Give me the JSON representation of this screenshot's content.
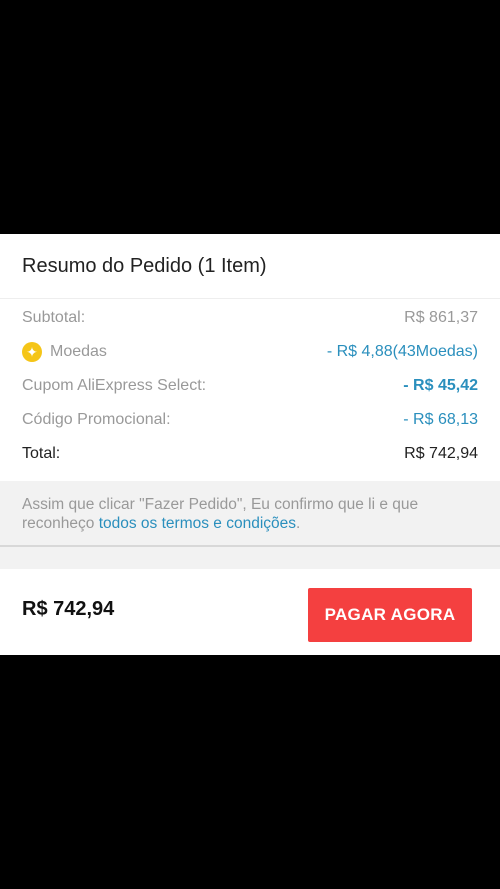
{
  "summary": {
    "title": "Resumo do Pedido (1 Item)",
    "rows": [
      {
        "label": "Subtotal:",
        "value": "R$ 861,37"
      },
      {
        "label": "Moedas",
        "value": "- R$ 4,88(43Moedas)",
        "icon": "coin-icon"
      },
      {
        "label": "Cupom AliExpress Select:",
        "value": "- R$ 45,42"
      },
      {
        "label": "Código Promocional:",
        "value": "- R$ 68,13"
      },
      {
        "label": "Total:",
        "value": "R$ 742,94"
      }
    ]
  },
  "terms": {
    "text": "Assim que clicar \"Fazer Pedido\", Eu confirmo que li e que reconheço ",
    "link": "todos os termos e condições",
    "suffix": "."
  },
  "footer": {
    "total": "R$ 742,94",
    "pay_label": "PAGAR AGORA"
  },
  "colors": {
    "accent_red": "#f44040",
    "link_blue": "#2a8fbd",
    "coin_yellow": "#f5c518"
  }
}
